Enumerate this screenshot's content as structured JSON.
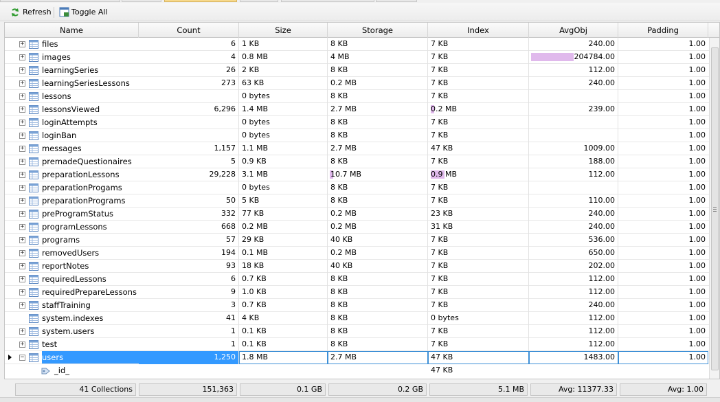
{
  "toolbar": {
    "refresh_label": "Refresh",
    "toggle_all_label": "Toggle All"
  },
  "columns": [
    "Name",
    "Count",
    "Size",
    "Storage",
    "Index",
    "AvgObj",
    "Padding"
  ],
  "rows": [
    {
      "name": "files",
      "count": "6",
      "size": "1 KB",
      "storage": "8 KB",
      "index": "7 KB",
      "avgobj": "240.00",
      "padding": "1.00"
    },
    {
      "name": "images",
      "count": "4",
      "size": "0.8 MB",
      "storage": "4 MB",
      "index": "7 KB",
      "avgobj": "204784.00",
      "padding": "1.00"
    },
    {
      "name": "learningSeries",
      "count": "26",
      "size": "2 KB",
      "storage": "8 KB",
      "index": "7 KB",
      "avgobj": "112.00",
      "padding": "1.00"
    },
    {
      "name": "learningSeriesLessons",
      "count": "273",
      "size": "63 KB",
      "storage": "0.2 MB",
      "index": "7 KB",
      "avgobj": "240.00",
      "padding": "1.00"
    },
    {
      "name": "lessons",
      "count": "",
      "size": "0 bytes",
      "storage": "8 KB",
      "index": "7 KB",
      "avgobj": "",
      "padding": "1.00"
    },
    {
      "name": "lessonsViewed",
      "count": "6,296",
      "size": "1.4 MB",
      "storage": "2.7 MB",
      "index": "0.2 MB",
      "avgobj": "239.00",
      "padding": "1.00"
    },
    {
      "name": "loginAttempts",
      "count": "",
      "size": "0 bytes",
      "storage": "8 KB",
      "index": "7 KB",
      "avgobj": "",
      "padding": "1.00"
    },
    {
      "name": "loginBan",
      "count": "",
      "size": "0 bytes",
      "storage": "8 KB",
      "index": "7 KB",
      "avgobj": "",
      "padding": "1.00"
    },
    {
      "name": "messages",
      "count": "1,157",
      "size": "1.1 MB",
      "storage": "2.7 MB",
      "index": "47 KB",
      "avgobj": "1009.00",
      "padding": "1.00"
    },
    {
      "name": "premadeQuestionaires",
      "count": "5",
      "size": "0.9 KB",
      "storage": "8 KB",
      "index": "7 KB",
      "avgobj": "188.00",
      "padding": "1.00"
    },
    {
      "name": "preparationLessons",
      "count": "29,228",
      "size": "3.1 MB",
      "storage": "10.7 MB",
      "index": "0.9 MB",
      "avgobj": "112.00",
      "padding": "1.00"
    },
    {
      "name": "preparationProgams",
      "count": "",
      "size": "0 bytes",
      "storage": "8 KB",
      "index": "7 KB",
      "avgobj": "",
      "padding": "1.00"
    },
    {
      "name": "preparationPrograms",
      "count": "50",
      "size": "5 KB",
      "storage": "8 KB",
      "index": "7 KB",
      "avgobj": "110.00",
      "padding": "1.00"
    },
    {
      "name": "preProgramStatus",
      "count": "332",
      "size": "77 KB",
      "storage": "0.2 MB",
      "index": "23 KB",
      "avgobj": "240.00",
      "padding": "1.00"
    },
    {
      "name": "programLessons",
      "count": "668",
      "size": "0.2 MB",
      "storage": "0.2 MB",
      "index": "31 KB",
      "avgobj": "240.00",
      "padding": "1.00"
    },
    {
      "name": "programs",
      "count": "57",
      "size": "29 KB",
      "storage": "40 KB",
      "index": "7 KB",
      "avgobj": "536.00",
      "padding": "1.00"
    },
    {
      "name": "removedUsers",
      "count": "194",
      "size": "0.1 MB",
      "storage": "0.2 MB",
      "index": "7 KB",
      "avgobj": "650.00",
      "padding": "1.00"
    },
    {
      "name": "reportNotes",
      "count": "93",
      "size": "18 KB",
      "storage": "40 KB",
      "index": "7 KB",
      "avgobj": "202.00",
      "padding": "1.00"
    },
    {
      "name": "requiredLessons",
      "count": "6",
      "size": "0.7 KB",
      "storage": "8 KB",
      "index": "7 KB",
      "avgobj": "112.00",
      "padding": "1.00"
    },
    {
      "name": "requiredPrepareLessons",
      "count": "9",
      "size": "1.0 KB",
      "storage": "8 KB",
      "index": "7 KB",
      "avgobj": "112.00",
      "padding": "1.00"
    },
    {
      "name": "staffTraining",
      "count": "3",
      "size": "0.7 KB",
      "storage": "8 KB",
      "index": "7 KB",
      "avgobj": "240.00",
      "padding": "1.00"
    },
    {
      "name": "system.indexes",
      "count": "41",
      "size": "4 KB",
      "storage": "8 KB",
      "index": "0 bytes",
      "avgobj": "112.00",
      "padding": "1.00"
    },
    {
      "name": "system.users",
      "count": "1",
      "size": "0.1 KB",
      "storage": "8 KB",
      "index": "7 KB",
      "avgobj": "112.00",
      "padding": "1.00"
    },
    {
      "name": "test",
      "count": "1",
      "size": "0.1 KB",
      "storage": "8 KB",
      "index": "7 KB",
      "avgobj": "112.00",
      "padding": "1.00"
    },
    {
      "name": "users",
      "count": "1,250",
      "size": "1.8 MB",
      "storage": "2.7 MB",
      "index": "47 KB",
      "avgobj": "1483.00",
      "padding": "1.00"
    }
  ],
  "index_row": {
    "name": "_id_",
    "index": "47 KB"
  },
  "footer": {
    "collections": "41 Collections",
    "count": "151,363",
    "size": "0.1 GB",
    "storage": "0.2 GB",
    "index": "5.1 MB",
    "avgobj": "Avg: 11377.33",
    "padding": "Avg: 1.00"
  },
  "colors": {
    "selection": "#3399ff",
    "bar": "#e0b9ec",
    "active_tab": "#f7d98c"
  }
}
